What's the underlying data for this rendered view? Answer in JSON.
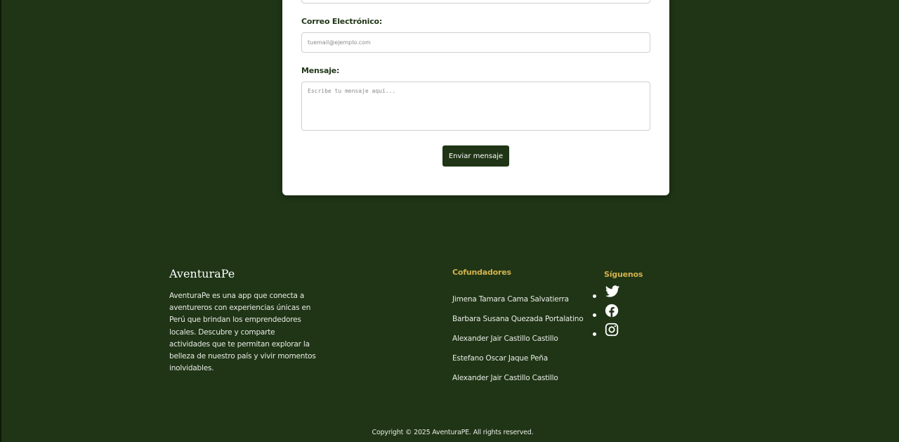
{
  "contact_form": {
    "email_label": "Correo Electrónico:",
    "email_placeholder": "tuemail@ejemplo.com",
    "message_label": "Mensaje:",
    "message_placeholder": "Escribe tu mensaje aquí...",
    "submit_label": "Enviar mensaje"
  },
  "footer": {
    "brand": "AventuraPe",
    "description": "AventuraPe es una app que conecta a aventureros con experiencias únicas en Perú que brindan los emprendedores locales. Descubre y comparte actividades que te permitan explorar la belleza de nuestro país y vivir momentos inolvidables.",
    "cofounders_title": "Cofundadores",
    "cofounders": [
      "Jimena Tamara Cama Salvatierra",
      "Barbara Susana Quezada Portalatino",
      "Alexander Jair Castillo Castillo",
      "Estefano Oscar Jaque Peña",
      "Alexander Jair Castillo Castillo"
    ],
    "follow_title": "Síguenos",
    "social_icons": [
      "twitter-icon",
      "facebook-icon",
      "instagram-icon"
    ],
    "copyright": "Copyright © 2025 AventuraPE. All rights reserved."
  },
  "colors": {
    "background": "#1f3516",
    "accent": "#d4b24c",
    "card": "#ffffff"
  }
}
